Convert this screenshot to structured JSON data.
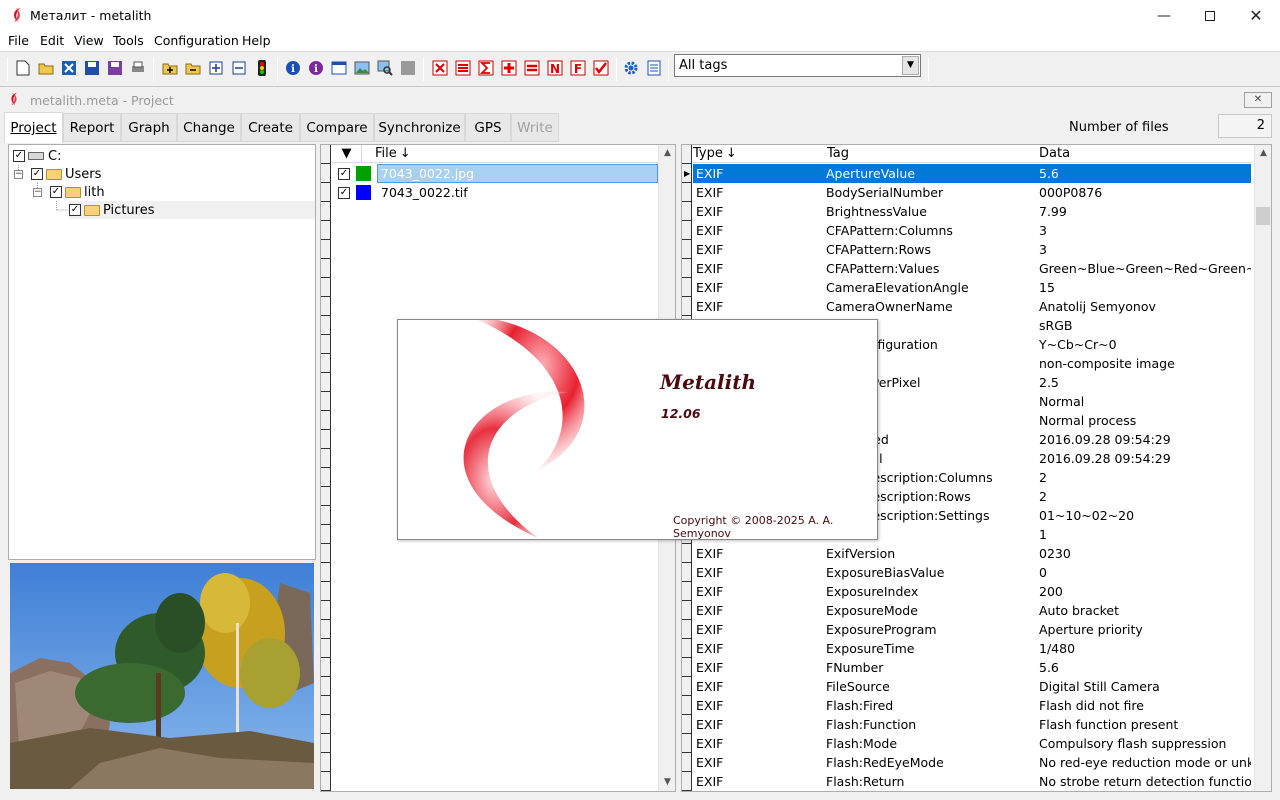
{
  "window": {
    "title": "Металит - metalith"
  },
  "menu": [
    "File",
    "Edit",
    "View",
    "Tools",
    "Configuration",
    "Help"
  ],
  "toolbar": {
    "tag_filter_value": "All tags",
    "icons": [
      "new-icon",
      "open-icon",
      "close-icon",
      "save-icon",
      "save-as-icon",
      "print-icon",
      "add-folder-icon",
      "remove-folder-icon",
      "expand-icon",
      "collapse-icon",
      "traffic-light-icon",
      "info-icon",
      "info-purple-icon",
      "window-icon",
      "image-icon",
      "image-search-icon",
      "gray-square-icon",
      "delete-tag-icon",
      "delete-tags-icon",
      "sum-icon",
      "plus-tag-icon",
      "equals-tag-icon",
      "n-tag-icon",
      "f-tag-icon",
      "check-tag-icon",
      "settings-icon",
      "notes-icon"
    ]
  },
  "child_window": {
    "title": "metalith.meta - Project"
  },
  "tabs": [
    {
      "label": "Project",
      "active": true
    },
    {
      "label": "Report"
    },
    {
      "label": "Graph"
    },
    {
      "label": "Change"
    },
    {
      "label": "Create"
    },
    {
      "label": "Compare"
    },
    {
      "label": "Synchronize"
    },
    {
      "label": "GPS"
    },
    {
      "label": "Write",
      "disabled": true
    }
  ],
  "files_count": {
    "label": "Number of files",
    "value": "2"
  },
  "tree": [
    {
      "label": "C:",
      "level": 0,
      "type": "drive"
    },
    {
      "label": "Users",
      "level": 1,
      "type": "folder"
    },
    {
      "label": "lith",
      "level": 2,
      "type": "folder"
    },
    {
      "label": "Pictures",
      "level": 3,
      "type": "folder",
      "selected": true
    }
  ],
  "files": {
    "header": "File",
    "rows": [
      {
        "name": "7043_0022.jpg",
        "color": "#00a000",
        "selected": true
      },
      {
        "name": "7043_0022.tif",
        "color": "#0000ff"
      }
    ]
  },
  "exif": {
    "headers": {
      "type": "Type",
      "tag": "Tag",
      "data": "Data"
    },
    "rows": [
      {
        "type": "EXIF",
        "tag": "ApertureValue",
        "data": "5.6"
      },
      {
        "type": "EXIF",
        "tag": "BodySerialNumber",
        "data": "000P0876"
      },
      {
        "type": "EXIF",
        "tag": "BrightnessValue",
        "data": "7.99"
      },
      {
        "type": "EXIF",
        "tag": "CFAPattern:Columns",
        "data": "3"
      },
      {
        "type": "EXIF",
        "tag": "CFAPattern:Rows",
        "data": "3"
      },
      {
        "type": "EXIF",
        "tag": "CFAPattern:Values",
        "data": "Green~Blue~Green~Red~Green~"
      },
      {
        "type": "EXIF",
        "tag": "CameraElevationAngle",
        "data": "15"
      },
      {
        "type": "EXIF",
        "tag": "CameraOwnerName",
        "data": "Anatolij Semyonov"
      },
      {
        "type": "",
        "tag": "ace",
        "data": "sRGB"
      },
      {
        "type": "",
        "tag": "entsConfiguration",
        "data": "Y~Cb~Cr~0"
      },
      {
        "type": "",
        "tag": "teImage",
        "data": "non-composite image"
      },
      {
        "type": "",
        "tag": "sedBitsPerPixel",
        "data": "2.5"
      },
      {
        "type": "",
        "tag": "",
        "data": "Normal"
      },
      {
        "type": "",
        "tag": "endered",
        "data": "Normal process"
      },
      {
        "type": "",
        "tag": "eDigitized",
        "data": "2016.09.28 09:54:29"
      },
      {
        "type": "",
        "tag": "eOriginal",
        "data": "2016.09.28 09:54:29"
      },
      {
        "type": "",
        "tag": "ettingDescription:Columns",
        "data": "2"
      },
      {
        "type": "",
        "tag": "ettingDescription:Rows",
        "data": "2"
      },
      {
        "type": "",
        "tag": "ettingDescription:Settings",
        "data": "01~10~02~20"
      },
      {
        "type": "",
        "tag": "omRatio",
        "data": "1"
      },
      {
        "type": "EXIF",
        "tag": "ExifVersion",
        "data": "0230"
      },
      {
        "type": "EXIF",
        "tag": "ExposureBiasValue",
        "data": "0"
      },
      {
        "type": "EXIF",
        "tag": "ExposureIndex",
        "data": "200"
      },
      {
        "type": "EXIF",
        "tag": "ExposureMode",
        "data": "Auto bracket"
      },
      {
        "type": "EXIF",
        "tag": "ExposureProgram",
        "data": "Aperture priority"
      },
      {
        "type": "EXIF",
        "tag": "ExposureTime",
        "data": "1/480"
      },
      {
        "type": "EXIF",
        "tag": "FNumber",
        "data": "5.6"
      },
      {
        "type": "EXIF",
        "tag": "FileSource",
        "data": "Digital Still Camera"
      },
      {
        "type": "EXIF",
        "tag": "Flash:Fired",
        "data": "Flash did not fire"
      },
      {
        "type": "EXIF",
        "tag": "Flash:Function",
        "data": "Flash function present"
      },
      {
        "type": "EXIF",
        "tag": "Flash:Mode",
        "data": "Compulsory flash suppression"
      },
      {
        "type": "EXIF",
        "tag": "Flash:RedEyeMode",
        "data": "No red-eye reduction mode or unkn"
      },
      {
        "type": "EXIF",
        "tag": "Flash:Return",
        "data": "No strobe return detection function"
      }
    ]
  },
  "splash": {
    "app_name": "Metalith",
    "version": "12.06",
    "copyright": "Copyright ©  2008-2025  A. A. Semyonov"
  }
}
